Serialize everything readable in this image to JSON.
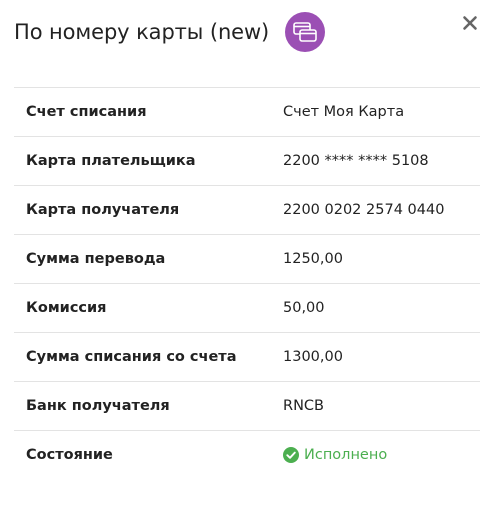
{
  "dialog": {
    "title": "По номеру карты (new)",
    "icon": "cards-icon",
    "close_icon": "close-icon",
    "accent_color": "#9b4fb4"
  },
  "details": [
    {
      "label": "Счет списания",
      "value": "Счет Моя Карта"
    },
    {
      "label": "Карта плательщика",
      "value": "2200 **** **** 5108"
    },
    {
      "label": "Карта получателя",
      "value": "2200 0202 2574 0440"
    },
    {
      "label": "Сумма перевода",
      "value": "1250,00"
    },
    {
      "label": "Комиссия",
      "value": "50,00"
    },
    {
      "label": "Сумма списания со счета",
      "value": "1300,00"
    },
    {
      "label": "Банк получателя",
      "value": "RNCB"
    },
    {
      "label": "Состояние",
      "value": "Исполнено",
      "icon": "check-circle-icon",
      "color": "#4caf50"
    }
  ]
}
